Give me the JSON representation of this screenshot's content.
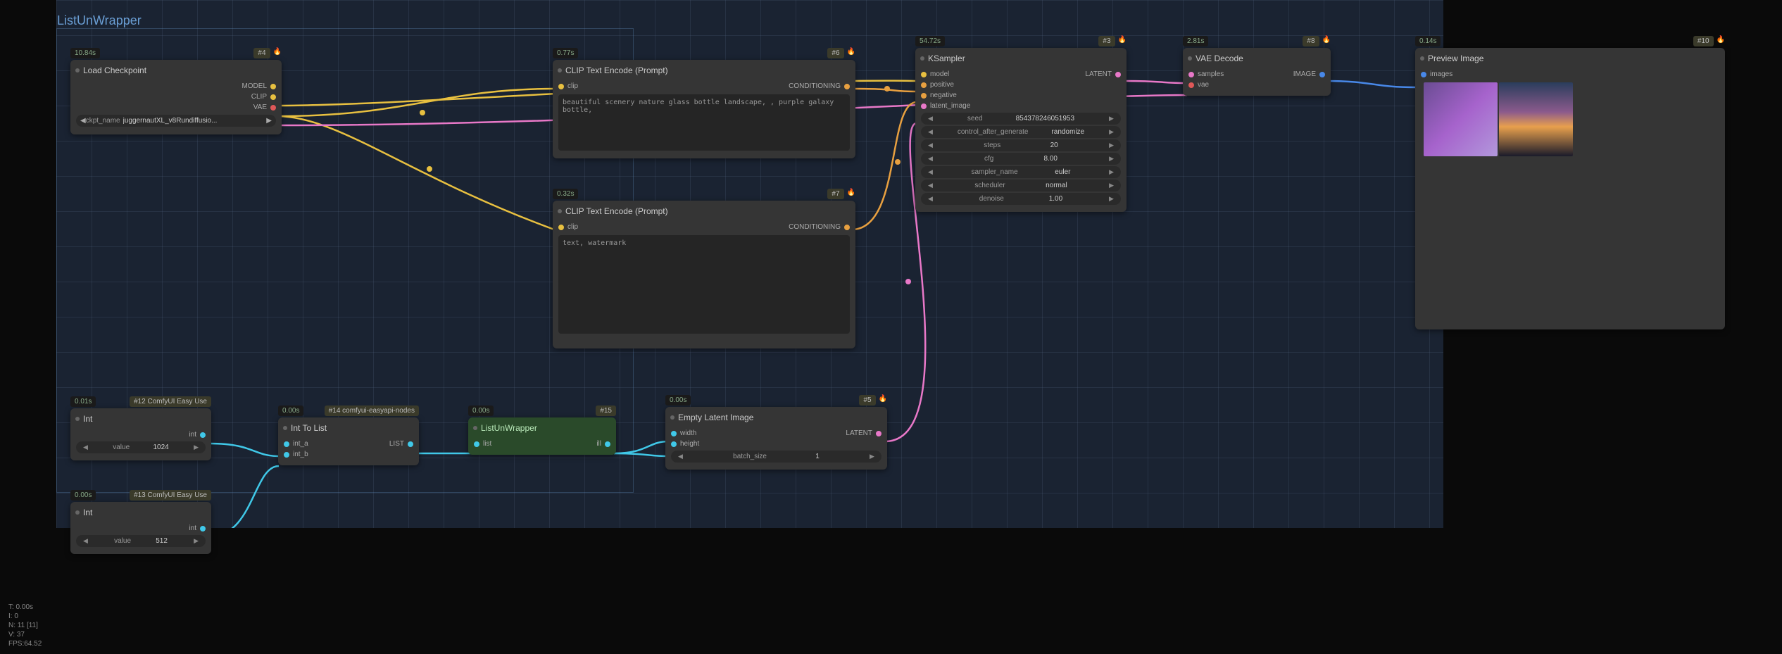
{
  "group": {
    "title": "ListUnWrapper"
  },
  "nodes": {
    "load_checkpoint": {
      "time": "10.84s",
      "id": "#4",
      "title": "Load Checkpoint",
      "out": {
        "model": "MODEL",
        "clip": "CLIP",
        "vae": "VAE"
      },
      "widgets": {
        "ckpt_label": "ckpt_name",
        "ckpt_value": "juggernautXL_v8Rundiffusio..."
      }
    },
    "clip1": {
      "time": "0.77s",
      "id": "#6",
      "title": "CLIP Text Encode (Prompt)",
      "in": {
        "clip": "clip"
      },
      "out": {
        "conditioning": "CONDITIONING"
      },
      "text": "beautiful scenery nature glass bottle landscape, , purple galaxy bottle,"
    },
    "clip2": {
      "time": "0.32s",
      "id": "#7",
      "title": "CLIP Text Encode (Prompt)",
      "in": {
        "clip": "clip"
      },
      "out": {
        "conditioning": "CONDITIONING"
      },
      "text": "text, watermark"
    },
    "ksampler": {
      "time": "54.72s",
      "id": "#3",
      "title": "KSampler",
      "in": {
        "model": "model",
        "positive": "positive",
        "negative": "negative",
        "latent_image": "latent_image"
      },
      "out": {
        "latent": "LATENT"
      },
      "widgets": [
        {
          "label": "seed",
          "value": "854378246051953"
        },
        {
          "label": "control_after_generate",
          "value": "randomize"
        },
        {
          "label": "steps",
          "value": "20"
        },
        {
          "label": "cfg",
          "value": "8.00"
        },
        {
          "label": "sampler_name",
          "value": "euler"
        },
        {
          "label": "scheduler",
          "value": "normal"
        },
        {
          "label": "denoise",
          "value": "1.00"
        }
      ]
    },
    "vae_decode": {
      "time": "2.81s",
      "id": "#8",
      "title": "VAE Decode",
      "in": {
        "samples": "samples",
        "vae": "vae"
      },
      "out": {
        "image": "IMAGE"
      }
    },
    "preview": {
      "time": "0.14s",
      "id": "#10",
      "title": "Preview Image",
      "in": {
        "images": "images"
      }
    },
    "int1": {
      "time": "0.01s",
      "id": "#12 ComfyUI Easy Use",
      "title": "Int",
      "out": {
        "int": "int"
      },
      "widgets": {
        "value_label": "value",
        "value": "1024"
      }
    },
    "int2": {
      "time": "0.00s",
      "id": "#13 ComfyUI Easy Use",
      "title": "Int",
      "out": {
        "int": "int"
      },
      "widgets": {
        "value_label": "value",
        "value": "512"
      }
    },
    "int_to_list": {
      "time": "0.00s",
      "id": "#14 comfyui-easyapi-nodes",
      "title": "Int To List",
      "in": {
        "int_a": "int_a",
        "int_b": "int_b"
      },
      "out": {
        "list": "LIST"
      }
    },
    "list_unwrapper": {
      "time": "0.00s",
      "id": "#15",
      "title": "ListUnWrapper",
      "in": {
        "list": "list"
      },
      "out": {
        "ill": "ill"
      }
    },
    "empty_latent": {
      "time": "0.00s",
      "id": "#5",
      "title": "Empty Latent Image",
      "in": {
        "width": "width",
        "height": "height"
      },
      "out": {
        "latent": "LATENT"
      },
      "widgets": {
        "batch_label": "batch_size",
        "batch_value": "1"
      }
    }
  },
  "debug": {
    "t": "T: 0.00s",
    "i": "I: 0",
    "n": "N: 11 [11]",
    "v": "V: 37",
    "fps": "FPS:64.52"
  },
  "fire": "🔥"
}
